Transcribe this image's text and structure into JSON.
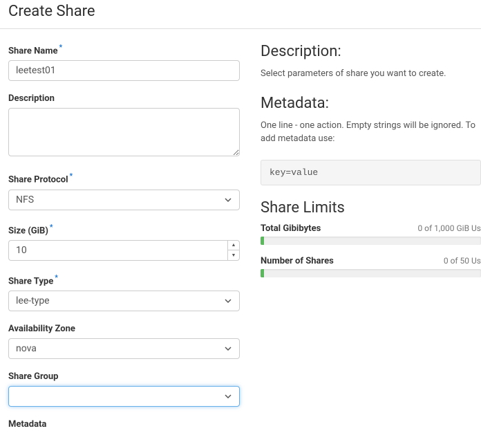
{
  "header": {
    "title": "Create Share"
  },
  "form": {
    "shareName": {
      "label": "Share Name",
      "value": "leetest01",
      "required": true
    },
    "description": {
      "label": "Description",
      "value": ""
    },
    "shareProtocol": {
      "label": "Share Protocol",
      "value": "NFS",
      "required": true
    },
    "size": {
      "label": "Size (GiB)",
      "value": "10",
      "required": true
    },
    "shareType": {
      "label": "Share Type",
      "value": "lee-type",
      "required": true
    },
    "availabilityZone": {
      "label": "Availability Zone",
      "value": "nova"
    },
    "shareGroup": {
      "label": "Share Group",
      "value": ""
    },
    "metadata": {
      "label": "Metadata"
    }
  },
  "info": {
    "descriptionHeading": "Description:",
    "descriptionText": "Select parameters of share you want to create.",
    "metadataHeading": "Metadata:",
    "metadataText": "One line - one action. Empty strings will be ignored. To add metadata use:",
    "metadataCode": "key=value",
    "limitsHeading": "Share Limits",
    "limits": {
      "gibibytes": {
        "label": "Total Gibibytes",
        "value": "0 of 1,000 GiB Us"
      },
      "shares": {
        "label": "Number of Shares",
        "value": "0 of 50 Us"
      }
    }
  }
}
